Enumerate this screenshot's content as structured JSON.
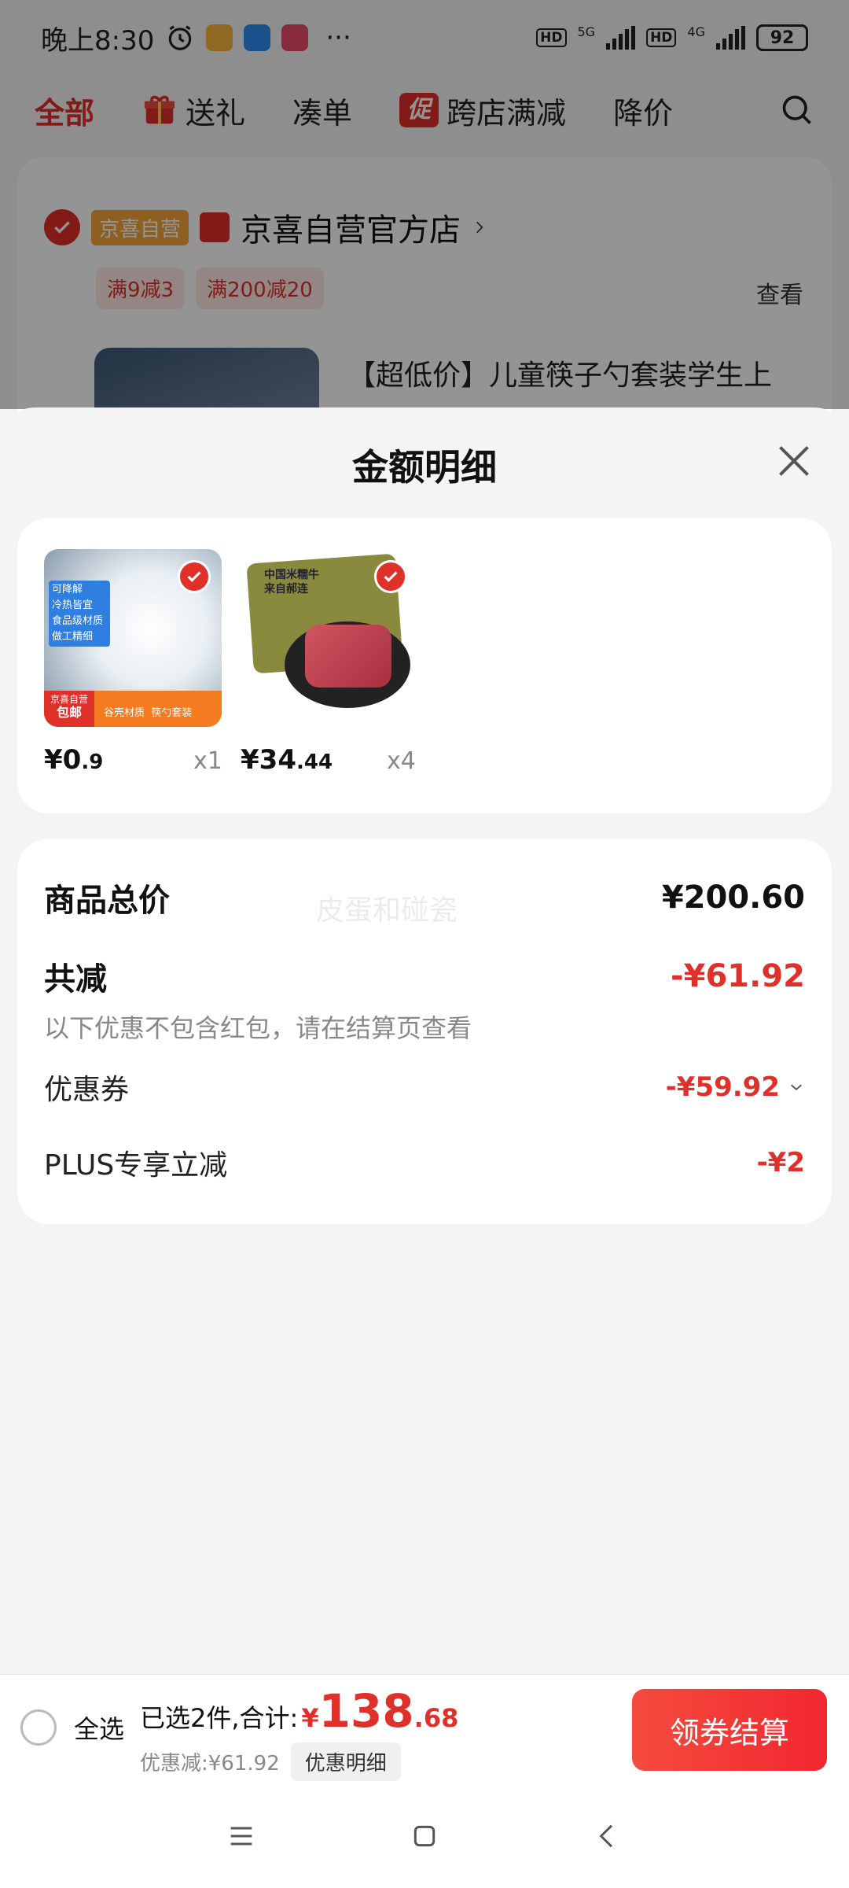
{
  "status_bar": {
    "time": "晚上8:30",
    "more": "···",
    "hd1": "HD",
    "net1": "5G",
    "hd2": "HD",
    "net2": "4G",
    "battery": "92"
  },
  "top_tabs": {
    "all": "全部",
    "gift": "送礼",
    "combine": "凑单",
    "promo_badge": "促",
    "cross_store": "跨店满减",
    "price_drop": "降价"
  },
  "store": {
    "tag": "京喜自营",
    "name": "京喜自营官方店",
    "promos": [
      "满9减3",
      "满200减20"
    ],
    "view": "查看",
    "item_title": "【超低价】儿童筷子勺套装学生上"
  },
  "sheet": {
    "title": "金额明细",
    "products": [
      {
        "price_int": "¥0",
        "price_dec": ".9",
        "qty": "x1"
      },
      {
        "price_int": "¥34",
        "price_dec": ".44",
        "qty": "x4"
      }
    ],
    "product1_labels": [
      "可降解",
      "冷热皆宜",
      "食品级材质",
      "做工精细",
      "京喜自营",
      "包邮",
      "谷壳材质  筷勺套装"
    ],
    "product2_labels": [
      "中国米糯牛",
      "来自郝连"
    ],
    "detail": {
      "total_label": "商品总价",
      "total_value": "¥200.60",
      "watermark": "皮蛋和碰瓷",
      "discount_label": "共减",
      "discount_value": "-¥61.92",
      "note": "以下优惠不包含红包，请在结算页查看",
      "coupon_label": "优惠券",
      "coupon_value": "-¥59.92",
      "plus_label": "PLUS专享立减",
      "plus_value": "-¥2"
    }
  },
  "bottom_bar": {
    "select_all": "全选",
    "selected_text": "已选2件,合计:",
    "currency": "¥",
    "total_int": "138",
    "total_dec": ".68",
    "discount_text": "优惠减:¥61.92",
    "discount_detail_button": "优惠明细",
    "checkout_button": "领券结算"
  },
  "colors": {
    "accent_red": "#e0302a",
    "checkout_gradient": "#f1272f",
    "tag_orange": "#f7a23a"
  },
  "icons": [
    "alarm-icon",
    "signal-icon",
    "battery-icon",
    "gift-icon",
    "search-icon",
    "close-icon",
    "check-icon",
    "chevron-right-icon",
    "chevron-down-icon",
    "menu-icon",
    "home-icon",
    "back-icon"
  ]
}
